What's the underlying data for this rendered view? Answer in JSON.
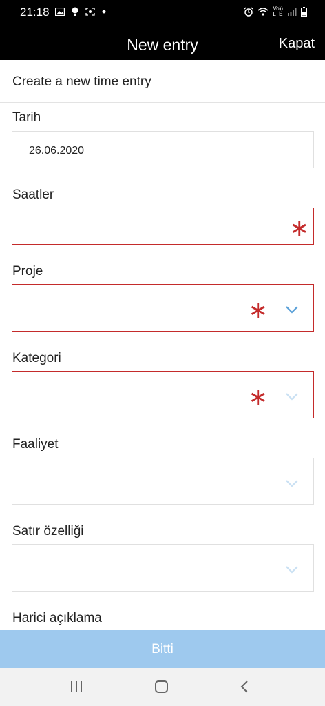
{
  "status_bar": {
    "time": "21:18",
    "left_icons": [
      "image-icon",
      "bulb-icon",
      "screenshot-icon",
      "dot-icon"
    ],
    "right_icons": [
      "alarm-icon",
      "wifi-icon",
      "volte-icon",
      "signal-icon",
      "battery-icon"
    ],
    "volte_text_top": "Vo))",
    "volte_text_bottom": "LTE"
  },
  "app_bar": {
    "title": "New entry",
    "close_label": "Kapat"
  },
  "subheader": {
    "text": "Create a new time entry"
  },
  "form": {
    "date": {
      "label": "Tarih",
      "value": "26.06.2020"
    },
    "hours": {
      "label": "Saatler",
      "value": "",
      "required": true
    },
    "project": {
      "label": "Proje",
      "value": "",
      "required": true
    },
    "category": {
      "label": "Kategori",
      "value": "",
      "required": true
    },
    "activity": {
      "label": "Faaliyet",
      "value": ""
    },
    "line_property": {
      "label": "Satır özelliği",
      "value": ""
    },
    "external_description": {
      "label": "Harici açıklama"
    }
  },
  "footer": {
    "done_label": "Bitti"
  },
  "colors": {
    "accent_blue": "#5aa0d8",
    "required_red": "#c42b2b",
    "done_button": "#9ec9ee",
    "bar_black": "#000000"
  }
}
